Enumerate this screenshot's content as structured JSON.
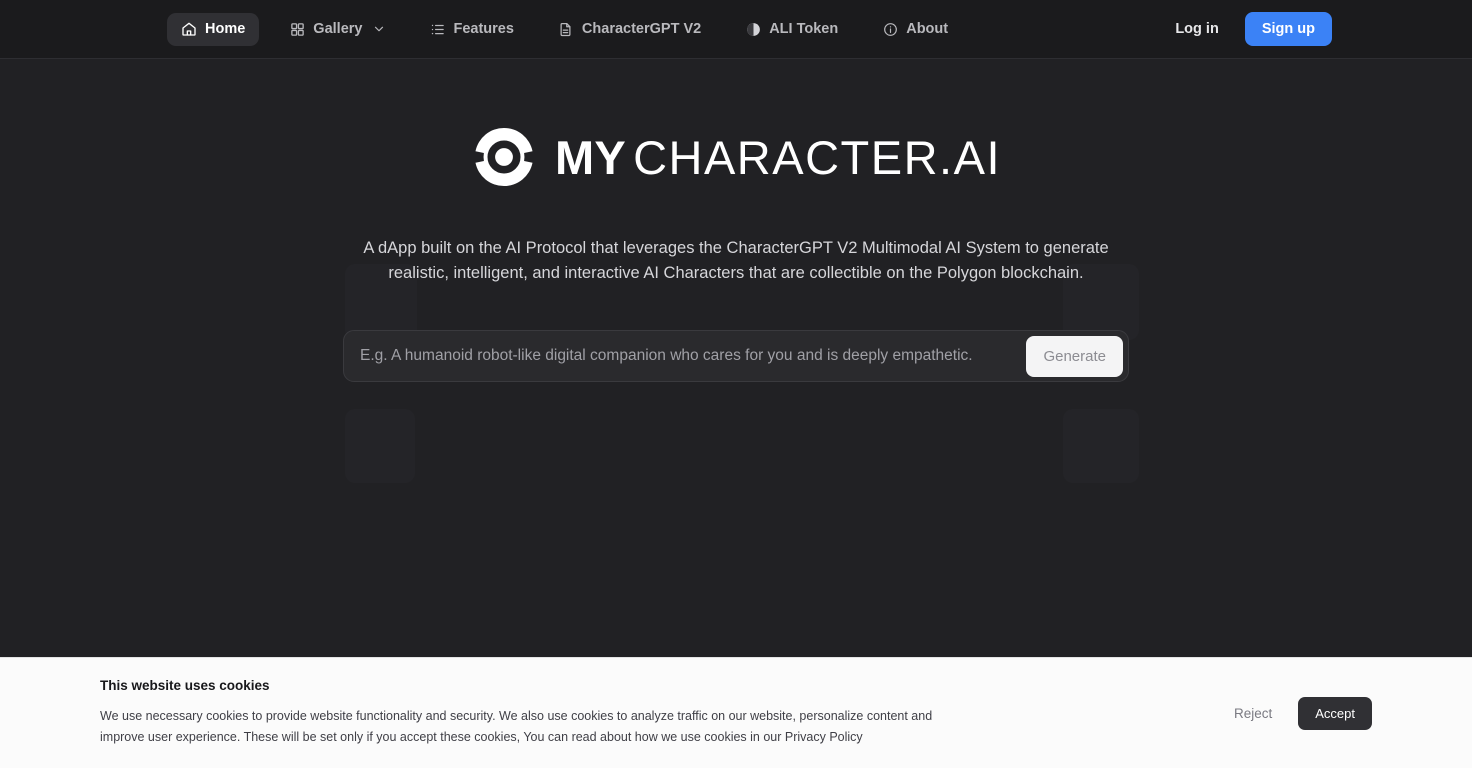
{
  "header": {
    "nav_items": [
      {
        "label": "Home",
        "icon": "home-icon",
        "active": true,
        "has_chevron": false
      },
      {
        "label": "Gallery",
        "icon": "grid-icon",
        "active": false,
        "has_chevron": true
      },
      {
        "label": "Features",
        "icon": "list-icon",
        "active": false,
        "has_chevron": false
      },
      {
        "label": "CharacterGPT V2",
        "icon": "document-icon",
        "active": false,
        "has_chevron": false
      },
      {
        "label": "ALI Token",
        "icon": "token-circle-icon",
        "active": false,
        "has_chevron": false
      },
      {
        "label": "About",
        "icon": "info-circle-icon",
        "active": false,
        "has_chevron": false
      }
    ],
    "login_label": "Log in",
    "signup_label": "Sign up",
    "accent_color": "#3b82f6"
  },
  "hero": {
    "logo_icon": "mycharacter-ring-icon",
    "wordmark_bold": "MY",
    "wordmark_rest": "CHARACTER.AI",
    "tagline": "A dApp built on the AI Protocol that leverages the CharacterGPT V2 Multimodal AI System to generate realistic, intelligent, and interactive AI Characters that are collectible on the Polygon blockchain.",
    "prompt_placeholder": "E.g. A humanoid robot-like digital companion who cares for you and is deeply empathetic.",
    "prompt_value": "",
    "generate_label": "Generate"
  },
  "cookie_banner": {
    "title": "This website uses cookies",
    "body": "We use necessary cookies to provide website functionality and security. We also use cookies to analyze traffic on our website, personalize content and improve user experience. These will be set only if you accept these cookies, You can read about how we use cookies in our Privacy Policy",
    "reject_label": "Reject",
    "accept_label": "Accept"
  }
}
